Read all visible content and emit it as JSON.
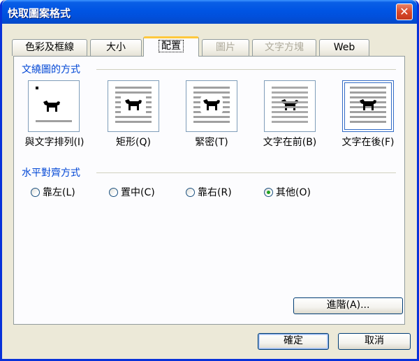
{
  "window": {
    "title": "快取圖案格式",
    "close_glyph": "✕"
  },
  "tabs": [
    {
      "label": "色彩及框線",
      "state": "normal"
    },
    {
      "label": "大小",
      "state": "normal"
    },
    {
      "label": "配置",
      "state": "active"
    },
    {
      "label": "圖片",
      "state": "disabled"
    },
    {
      "label": "文字方塊",
      "state": "disabled"
    },
    {
      "label": "Web",
      "state": "normal"
    }
  ],
  "wrapping": {
    "title": "文繞圖的方式",
    "options": [
      {
        "label": "與文字排列(I)",
        "icon": "inline-with-text-icon"
      },
      {
        "label": "矩形(Q)",
        "icon": "square-wrap-icon"
      },
      {
        "label": "緊密(T)",
        "icon": "tight-wrap-icon"
      },
      {
        "label": "文字在前(B)",
        "icon": "behind-text-icon"
      },
      {
        "label": "文字在後(F)",
        "icon": "in-front-of-text-icon"
      }
    ],
    "selected": "文字在後(F)"
  },
  "alignment": {
    "title": "水平對齊方式",
    "options": [
      {
        "label": "靠左(L)",
        "checked": false
      },
      {
        "label": "置中(C)",
        "checked": false
      },
      {
        "label": "靠右(R)",
        "checked": false
      },
      {
        "label": "其他(O)",
        "checked": true
      }
    ]
  },
  "buttons": {
    "advanced": "進階(A)...",
    "ok": "確定",
    "cancel": "取消"
  },
  "colors": {
    "title_bar": "#0054e3",
    "dialog_bg": "#ece9d8",
    "group_title": "#0046d5",
    "active_tab_accent": "#ffc83c",
    "radio_dot": "#21a121"
  }
}
